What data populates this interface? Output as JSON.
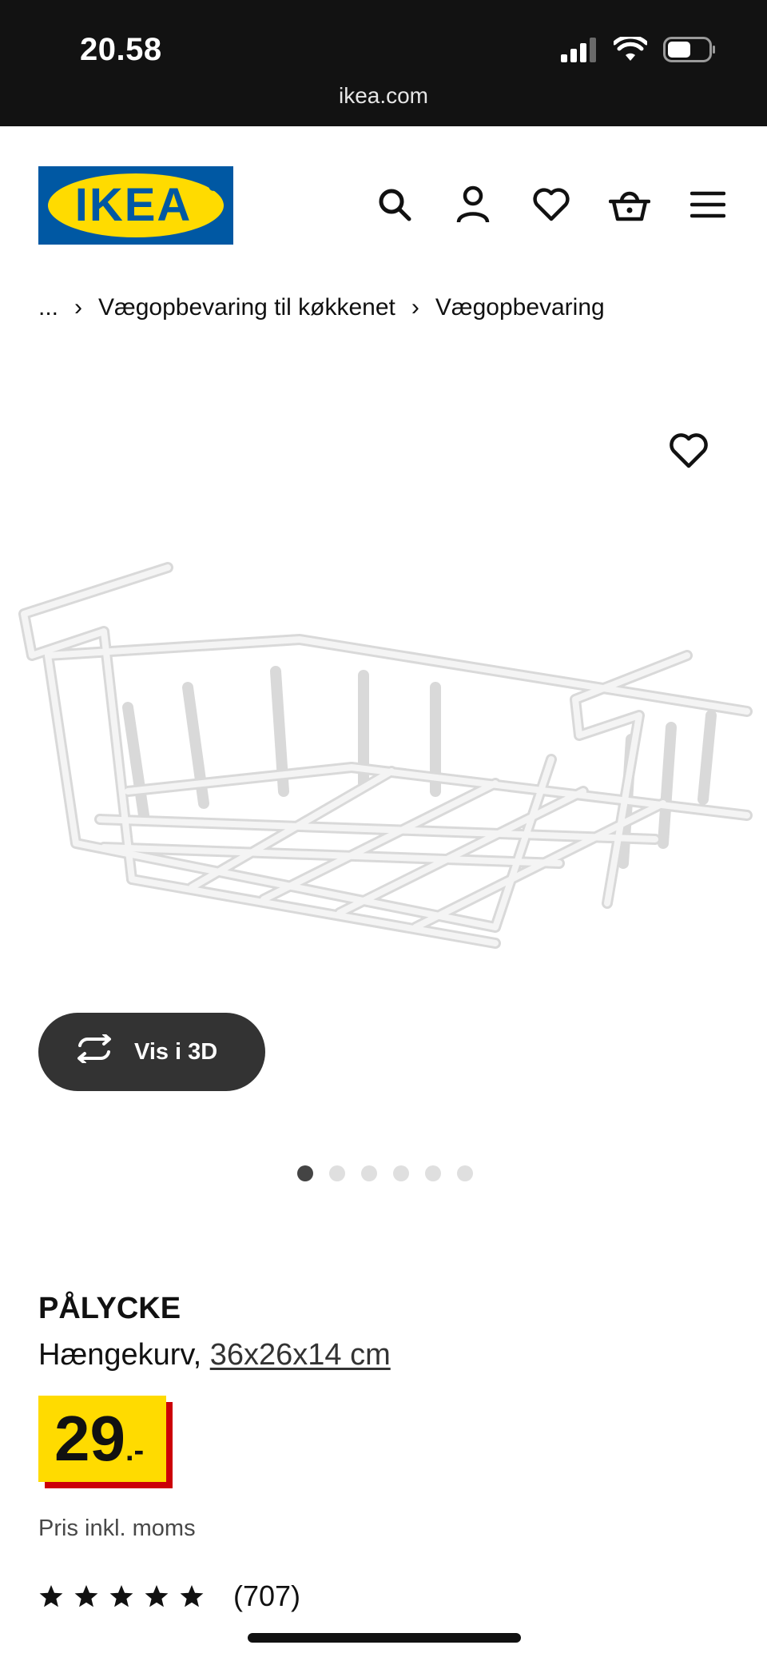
{
  "status_bar": {
    "time": "20.58",
    "signal_icon": "cellular-signal-icon",
    "wifi_icon": "wifi-icon",
    "battery_icon": "battery-icon",
    "url": "ikea.com"
  },
  "header": {
    "logo_text": "IKEA",
    "brand_colors": {
      "blue": "#0058a3",
      "yellow": "#ffdb00"
    },
    "icons": [
      "search-icon",
      "account-icon",
      "heart-icon",
      "basket-icon",
      "menu-icon"
    ]
  },
  "breadcrumb": {
    "items": [
      "...",
      "Vægopbevaring til køkkenet",
      "Vægopbevaring"
    ],
    "separator": "›"
  },
  "product": {
    "favourite_icon": "heart-icon",
    "image_alt": "white wire under-shelf basket",
    "view_3d_label": "Vis i 3D",
    "gallery_dots": 6,
    "gallery_active": 1,
    "name": "PÅLYCKE",
    "type": "Hængekurv, ",
    "size": "36x26x14 cm",
    "price_integer": "29",
    "price_suffix": ".-",
    "price_colors": {
      "box": "#ffdb00",
      "shadow": "#cc0008"
    },
    "price_note": "Pris inkl. moms",
    "rating_stars": 5,
    "review_count": "(707)"
  }
}
